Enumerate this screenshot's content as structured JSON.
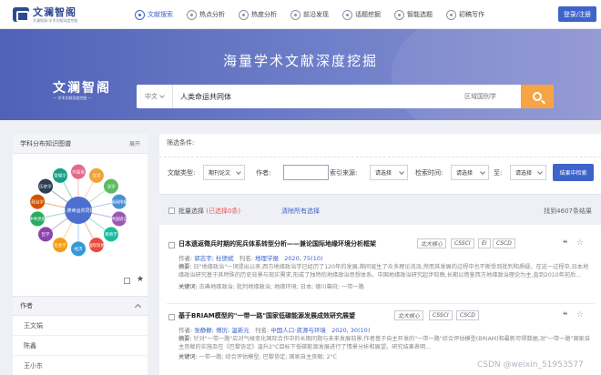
{
  "header": {
    "logo_cn": "文澜智阁",
    "logo_en": "文澜智阁·学术文献深度挖掘",
    "nav": [
      {
        "label": "文献搜索",
        "icon": "search-icon",
        "active": true
      },
      {
        "label": "热点分析",
        "icon": "fire-icon",
        "active": false
      },
      {
        "label": "热度分析",
        "icon": "chart-icon",
        "active": false
      },
      {
        "label": "前沿发现",
        "icon": "compass-icon",
        "active": false
      },
      {
        "label": "话题挖掘",
        "icon": "topic-icon",
        "active": false
      },
      {
        "label": "智能选题",
        "icon": "bulb-icon",
        "active": false
      },
      {
        "label": "初稿写作",
        "icon": "pen-icon",
        "active": false
      }
    ],
    "login_label": "登录/注册"
  },
  "banner": {
    "title": "海量学术文献深度挖掘",
    "brand_cn": "文澜智阁",
    "brand_en": "— 学术文献深度挖掘 —",
    "search_scope": "中文",
    "search_value": "人类命运共同体",
    "search_scope2": "区域国别学"
  },
  "left": {
    "graph_title": "学科分布知识图谱",
    "graph_more": "展开",
    "graph_center": "人类命运共同体",
    "graph_nodes": [
      "外国语",
      "文学",
      "法学",
      "新闻传播",
      "中国语言",
      "教育学",
      "国际贸易",
      "经济",
      "社会学",
      "哲学",
      "中共党史",
      "政治学",
      "历史学",
      "管理学"
    ],
    "author_title": "作者",
    "authors": [
      "王文娟",
      "陈鑫",
      "王小东"
    ]
  },
  "right": {
    "conditions_label": "筛选条件:",
    "filters": {
      "type_label": "文献类型:",
      "type_value": "期刊论文",
      "author_label": "作者:",
      "source_label": "索引来源:",
      "source_value": "请选择",
      "time_label": "检索时间:",
      "time_value": "请选择",
      "to_label": "至:",
      "to_value": "请选择",
      "button_label": "结果中检索"
    },
    "list_head": {
      "select_all": "批量选择",
      "selected": "(已选择0条)",
      "clear": "清除所有选择",
      "count": "找到4607条结果"
    },
    "results": [
      {
        "title": "日本遗返徵兵时期的宪兵体系转型分析——兼论国际地缘环境分析框架",
        "tags": [
          "北大核心",
          "CSSCI",
          "EI",
          "CSCD"
        ],
        "authors_label": "作者:",
        "authors": "郭志宇; 杜德斌",
        "source_label": "刊名:",
        "source": "地理学报",
        "year": "2020, 75(10)",
        "abstract_label": "摘要:",
        "abstract": "日\"地缘政治\"一词提出以来,西方地缘政治学已经历了120年的发展,期间诞生了众多理论流派,然而其发展的过程中也不断受到批判和质疑。在这一过程中,日本地缘政治研究基于其特殊的历史背景与现实需求,形成了独特的地缘政治思想体系。中国地缘政治研究起步较晚,长期以借鉴西方地缘政治理论为主,直到2010年前后...",
        "keywords_label": "关键词:",
        "keywords": "古典地缘政治; 批判地缘政治; 地缘环境; 日本; 德川幕府; 一带一路"
      },
      {
        "title": "基于BRIAM模型的\"一带一路\"国家低碳能源发展成效研究展望",
        "tags": [
          "北大核心",
          "CSSCI",
          "CSCD"
        ],
        "authors_label": "作者:",
        "authors": "张静静; 傅历; 温新元",
        "source_label": "刊名:",
        "source": "中国人口·资源与环境",
        "year": "2020, 30(10)",
        "abstract_label": "摘要:",
        "abstract": "针对\"一带一路\"应对气候变化国际合作中的长期问题与未来发展前景,作者基于自主开发的\"一带一路\"综合评估模型(BRIAM)和最新可得数据,对\"一带一路\"国家自主贡献的实施及在《巴黎协定》温升2°C目标下低碳能源发展进行了情景分析和展望。研究结果表明...",
        "keywords_label": "关键词:",
        "keywords": "一带一路; 综合评估模型; 巴黎协定; 国家自主贡献; 2°C"
      }
    ]
  },
  "watermark": "CSDN @weixin_51953577",
  "colors": {
    "primary": "#3e63c9",
    "search_button": "#f6a445",
    "banner": "#5c6fc0"
  }
}
